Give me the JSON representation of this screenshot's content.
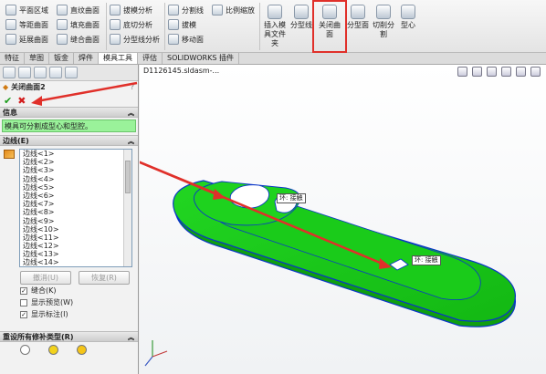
{
  "ribbon": {
    "col1": [
      "平面区域",
      "等距曲面",
      "延展曲面"
    ],
    "col2": [
      "直纹曲面",
      "填充曲面",
      "缝合曲面"
    ],
    "col3": [
      "拔模分析",
      "底切分析",
      "分型线分析"
    ],
    "col4": [
      "分割线",
      "拔模",
      "移动面"
    ],
    "col5": [
      "比例缩放"
    ],
    "big_buttons": [
      "插入模具文件夹",
      "分型线",
      "关闭曲面",
      "分型面",
      "切削分割",
      "型心"
    ]
  },
  "tabs": [
    "特征",
    "草图",
    "钣金",
    "焊件",
    "模具工具",
    "评估",
    "SOLIDWORKS 插件"
  ],
  "active_tab": "模具工具",
  "panel": {
    "feature_title": "关闭曲面2",
    "help": "?",
    "info_header": "信息",
    "info_text": "模具可分割成型心和型腔。",
    "edges_header": "边线(E)",
    "edges": [
      "边线<1>",
      "边线<2>",
      "边线<3>",
      "边线<4>",
      "边线<5>",
      "边线<6>",
      "边线<7>",
      "边线<8>",
      "边线<9>",
      "边线<10>",
      "边线<11>",
      "边线<12>",
      "边线<13>",
      "边线<14>"
    ],
    "undo_label": "撤消(U)",
    "redo_label": "恢复(R)",
    "checkboxes": [
      {
        "label": "缝合(K)",
        "checked": true
      },
      {
        "label": "显示预览(W)",
        "checked": false
      },
      {
        "label": "显示标注(I)",
        "checked": true
      }
    ],
    "reset_header": "重设所有修补类型(R)"
  },
  "viewport": {
    "doc_title": "D1126145.sldasm-...",
    "callout_1": "环: 接触",
    "callout_2": "环: 接触"
  },
  "colors": {
    "model_fill": "#19c719",
    "model_edge": "#0a36c8",
    "highlight": "#e0302a",
    "info_bg": "#9af29a"
  }
}
